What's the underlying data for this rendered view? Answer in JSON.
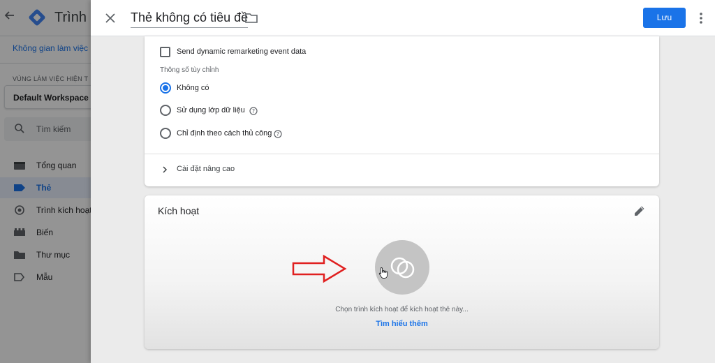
{
  "background_app": {
    "app_name": "Trình q",
    "workspace_tab": "Không gian làm việc",
    "current_workspace_label": "VÙNG LÀM VIỆC HIỆN T",
    "workspace_name": "Default Workspace",
    "search_placeholder": "Tìm kiếm",
    "nav_items": [
      {
        "label": "Tổng quan",
        "icon": "overview-icon"
      },
      {
        "label": "Thẻ",
        "icon": "tag-icon",
        "active": true
      },
      {
        "label": "Trình kích hoạt",
        "icon": "trigger-icon"
      },
      {
        "label": "Biến",
        "icon": "variables-icon"
      },
      {
        "label": "Thư mục",
        "icon": "folder-icon"
      },
      {
        "label": "Mẫu",
        "icon": "template-icon"
      }
    ]
  },
  "panel": {
    "title": "Thẻ không có tiêu đề",
    "save_label": "Lưu",
    "config": {
      "checkbox_label": "Send dynamic remarketing event data",
      "checkbox_checked": false,
      "custom_params_label": "Thông số tùy chỉnh",
      "radio_options": [
        {
          "label": "Không có",
          "checked": true,
          "help": false
        },
        {
          "label": "Sử dụng lớp dữ liệu",
          "checked": false,
          "help": true
        },
        {
          "label": "Chỉ định theo cách thủ công",
          "checked": false,
          "help": true
        }
      ],
      "advanced_label": "Cài đặt nâng cao"
    },
    "triggering": {
      "title": "Kích hoạt",
      "prompt": "Chọn trình kích hoạt để kích hoạt thẻ này...",
      "learn_more": "Tìm hiểu thêm"
    }
  },
  "colors": {
    "accent": "#1a73e8",
    "annotation_arrow": "#e02020"
  }
}
